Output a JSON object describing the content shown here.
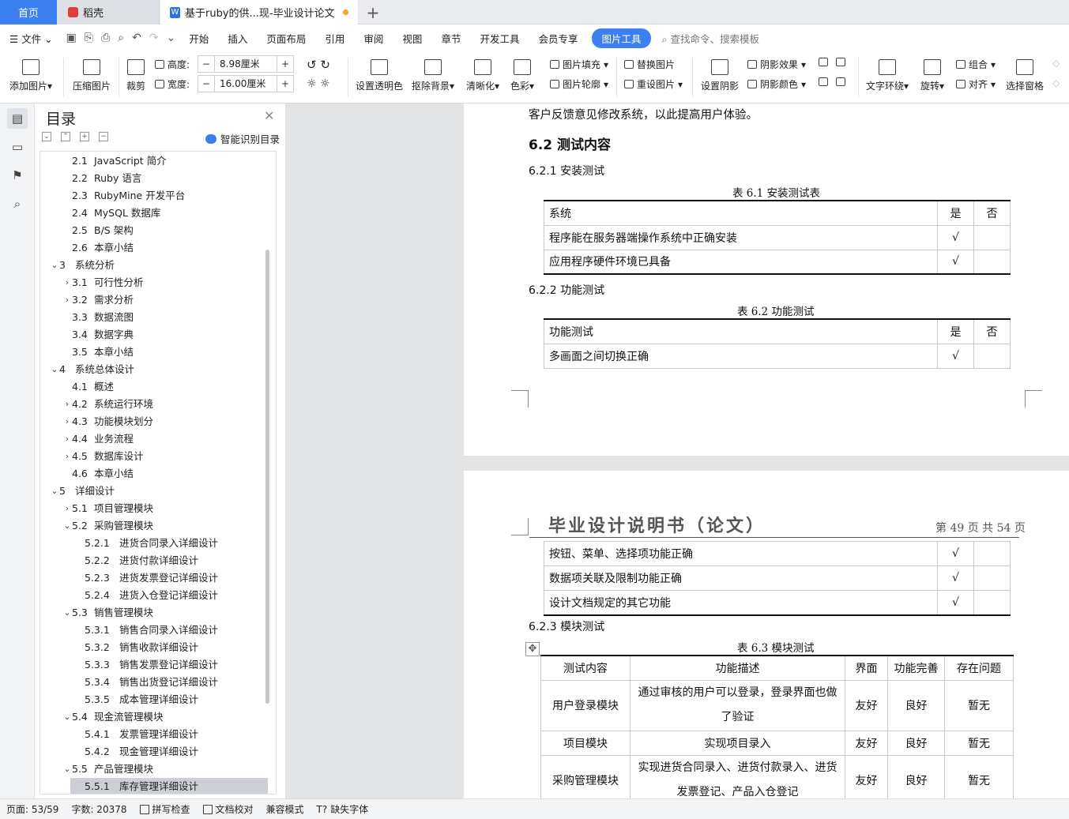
{
  "tabs": {
    "home": "首页",
    "daoke": "稻壳",
    "document": "基于ruby的供...现-毕业设计论文",
    "new_tab": "+"
  },
  "menu": {
    "file": "文件",
    "items": [
      "开始",
      "插入",
      "页面布局",
      "引用",
      "审阅",
      "视图",
      "章节",
      "开发工具",
      "会员专享"
    ],
    "picture_tools": "图片工具",
    "search": "查找命令、搜索模板"
  },
  "ribbon": {
    "add_picture": "添加图片",
    "compress": "压缩图片",
    "crop": "裁剪",
    "height_label": "高度:",
    "height_value": "8.98厘米",
    "width_label": "宽度:",
    "width_value": "16.00厘米",
    "transparent": "设置透明色",
    "remove_bg": "抠除背景",
    "sharpen": "清晰化",
    "color": "色彩",
    "fill": "图片填充",
    "outline": "图片轮廓",
    "replace": "替换图片",
    "reset": "重设图片",
    "shadow": "设置阴影",
    "shadow_effect": "阴影效果",
    "shadow_color": "阴影颜色",
    "wrap": "文字环绕",
    "rotate": "旋转",
    "group": "组合",
    "align": "对齐",
    "select_pane": "选择窗格"
  },
  "toc": {
    "title": "目录",
    "smart": "智能识别目录",
    "items": [
      {
        "num": "2.1",
        "text": "JavaScript 简介",
        "level": 2,
        "caret": ""
      },
      {
        "num": "2.2",
        "text": "Ruby 语言",
        "level": 2,
        "caret": ""
      },
      {
        "num": "2.3",
        "text": "RubyMine 开发平台",
        "level": 2,
        "caret": ""
      },
      {
        "num": "2.4",
        "text": "MySQL 数据库",
        "level": 2,
        "caret": ""
      },
      {
        "num": "2.5",
        "text": "B/S 架构",
        "level": 2,
        "caret": ""
      },
      {
        "num": "2.6",
        "text": "本章小结",
        "level": 2,
        "caret": ""
      },
      {
        "num": "3",
        "text": "系统分析",
        "level": 1,
        "caret": "v"
      },
      {
        "num": "3.1",
        "text": "可行性分析",
        "level": 2,
        "caret": ">"
      },
      {
        "num": "3.2",
        "text": "需求分析",
        "level": 2,
        "caret": ">"
      },
      {
        "num": "3.3",
        "text": "数据流图",
        "level": 2,
        "caret": ""
      },
      {
        "num": "3.4",
        "text": "数据字典",
        "level": 2,
        "caret": ""
      },
      {
        "num": "3.5",
        "text": "本章小结",
        "level": 2,
        "caret": ""
      },
      {
        "num": "4",
        "text": "系统总体设计",
        "level": 1,
        "caret": "v"
      },
      {
        "num": "4.1",
        "text": "概述",
        "level": 2,
        "caret": ""
      },
      {
        "num": "4.2",
        "text": "系统运行环境",
        "level": 2,
        "caret": ">"
      },
      {
        "num": "4.3",
        "text": "功能模块划分",
        "level": 2,
        "caret": ">"
      },
      {
        "num": "4.4",
        "text": "业务流程",
        "level": 2,
        "caret": ">"
      },
      {
        "num": "4.5",
        "text": "数据库设计",
        "level": 2,
        "caret": ">"
      },
      {
        "num": "4.6",
        "text": "本章小结",
        "level": 2,
        "caret": ""
      },
      {
        "num": "5",
        "text": "详细设计",
        "level": 1,
        "caret": "v"
      },
      {
        "num": "5.1",
        "text": "项目管理模块",
        "level": 2,
        "caret": ">"
      },
      {
        "num": "5.2",
        "text": "采购管理模块",
        "level": 2,
        "caret": "v"
      },
      {
        "num": "5.2.1",
        "text": "进货合同录入详细设计",
        "level": 3,
        "caret": ""
      },
      {
        "num": "5.2.2",
        "text": "进货付款详细设计",
        "level": 3,
        "caret": ""
      },
      {
        "num": "5.2.3",
        "text": "进货发票登记详细设计",
        "level": 3,
        "caret": ""
      },
      {
        "num": "5.2.4",
        "text": "进货入仓登记详细设计",
        "level": 3,
        "caret": ""
      },
      {
        "num": "5.3",
        "text": "销售管理模块",
        "level": 2,
        "caret": "v"
      },
      {
        "num": "5.3.1",
        "text": "销售合同录入详细设计",
        "level": 3,
        "caret": ""
      },
      {
        "num": "5.3.2",
        "text": "销售收款详细设计",
        "level": 3,
        "caret": ""
      },
      {
        "num": "5.3.3",
        "text": "销售发票登记详细设计",
        "level": 3,
        "caret": ""
      },
      {
        "num": "5.3.4",
        "text": "销售出货登记详细设计",
        "level": 3,
        "caret": ""
      },
      {
        "num": "5.3.5",
        "text": "成本管理详细设计",
        "level": 3,
        "caret": ""
      },
      {
        "num": "5.4",
        "text": "现金流管理模块",
        "level": 2,
        "caret": "v"
      },
      {
        "num": "5.4.1",
        "text": "发票管理详细设计",
        "level": 3,
        "caret": ""
      },
      {
        "num": "5.4.2",
        "text": "现金管理详细设计",
        "level": 3,
        "caret": ""
      },
      {
        "num": "5.5",
        "text": "产品管理模块",
        "level": 2,
        "caret": "v"
      },
      {
        "num": "5.5.1",
        "text": "库存管理详细设计",
        "level": 3,
        "caret": "",
        "selected": true
      }
    ]
  },
  "doc": {
    "p1_line": "客户反馈意见修改系统，以此提高用户体验。",
    "h_6_2": "6.2   测试内容",
    "h_6_2_1": "6.2.1   安装测试",
    "cap_6_1": "表 6.1  安装测试表",
    "t61_head": [
      "系统",
      "是",
      "否"
    ],
    "t61_rows": [
      [
        "程序能在服务器端操作系统中正确安装",
        "√",
        ""
      ],
      [
        "应用程序硬件环境已具备",
        "√",
        ""
      ]
    ],
    "h_6_2_2": "6.2.2   功能测试",
    "cap_6_2": "表 6.2  功能测试",
    "t62_head": [
      "功能测试",
      "是",
      "否"
    ],
    "t62_rows": [
      [
        "多画面之间切换正确",
        "√",
        ""
      ]
    ],
    "header_title": "毕业设计说明书（论文）",
    "header_page": "第 49 页 共 54 页",
    "t62_cont": [
      [
        "按钮、菜单、选择项功能正确",
        "√",
        ""
      ],
      [
        "数据项关联及限制功能正确",
        "√",
        ""
      ],
      [
        "设计文档规定的其它功能",
        "√",
        ""
      ]
    ],
    "h_6_2_3": "6.2.3   模块测试",
    "cap_6_3": "表 6.3  模块测试",
    "t63_head": [
      "测试内容",
      "功能描述",
      "界面",
      "功能完善",
      "存在问题"
    ],
    "t63_rows": [
      [
        "用户登录模块",
        "通过审核的用户可以登录，登录界面也做了验证",
        "友好",
        "良好",
        "暂无"
      ],
      [
        "项目模块",
        "实现项目录入",
        "友好",
        "良好",
        "暂无"
      ],
      [
        "采购管理模块",
        "实现进货合同录入、进货付款录入、进货发票登记、产品入仓登记",
        "友好",
        "良好",
        "暂无"
      ]
    ]
  },
  "status": {
    "page": "页面: 53/59",
    "words": "字数: 20378",
    "spell": "拼写检查",
    "proof": "文档校对",
    "compat": "兼容模式",
    "missing_font": "缺失字体"
  }
}
